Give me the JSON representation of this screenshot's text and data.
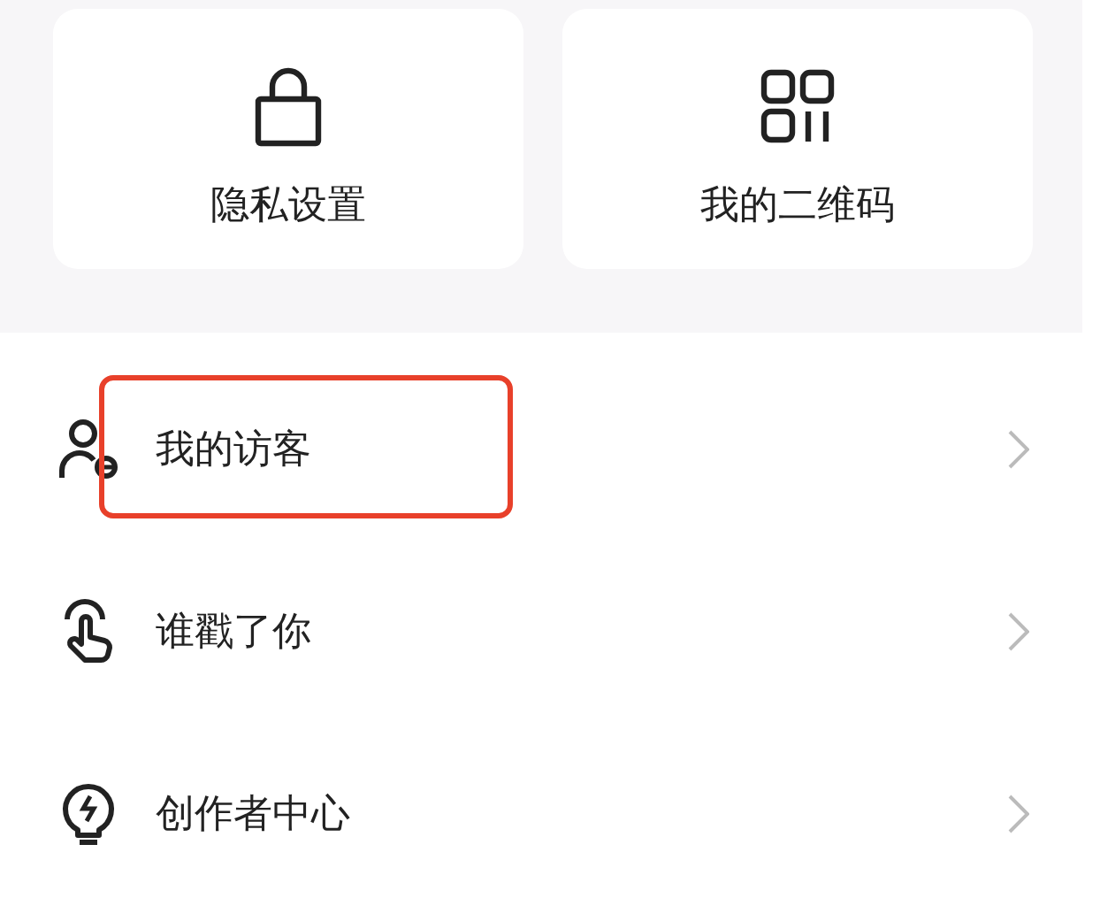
{
  "shortcuts": [
    {
      "label": "隐私设置"
    },
    {
      "label": "我的二维码"
    }
  ],
  "menu": [
    {
      "label": "我的访客",
      "highlighted": true
    },
    {
      "label": "谁戳了你",
      "highlighted": false
    },
    {
      "label": "创作者中心",
      "highlighted": false
    }
  ]
}
